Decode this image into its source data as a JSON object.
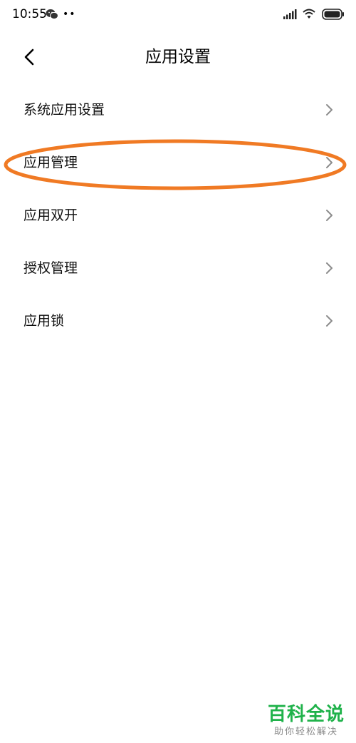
{
  "status_bar": {
    "time": "10:55",
    "dots": "••"
  },
  "header": {
    "title": "应用设置"
  },
  "menu": {
    "items": [
      {
        "label": "系统应用设置"
      },
      {
        "label": "应用管理"
      },
      {
        "label": "应用双开"
      },
      {
        "label": "授权管理"
      },
      {
        "label": "应用锁"
      }
    ]
  },
  "highlight": {
    "color": "#f07a24",
    "target": "应用管理"
  },
  "watermark": {
    "title": "百科全说",
    "subtitle": "助你轻松解决",
    "color": "#1fb24a"
  }
}
